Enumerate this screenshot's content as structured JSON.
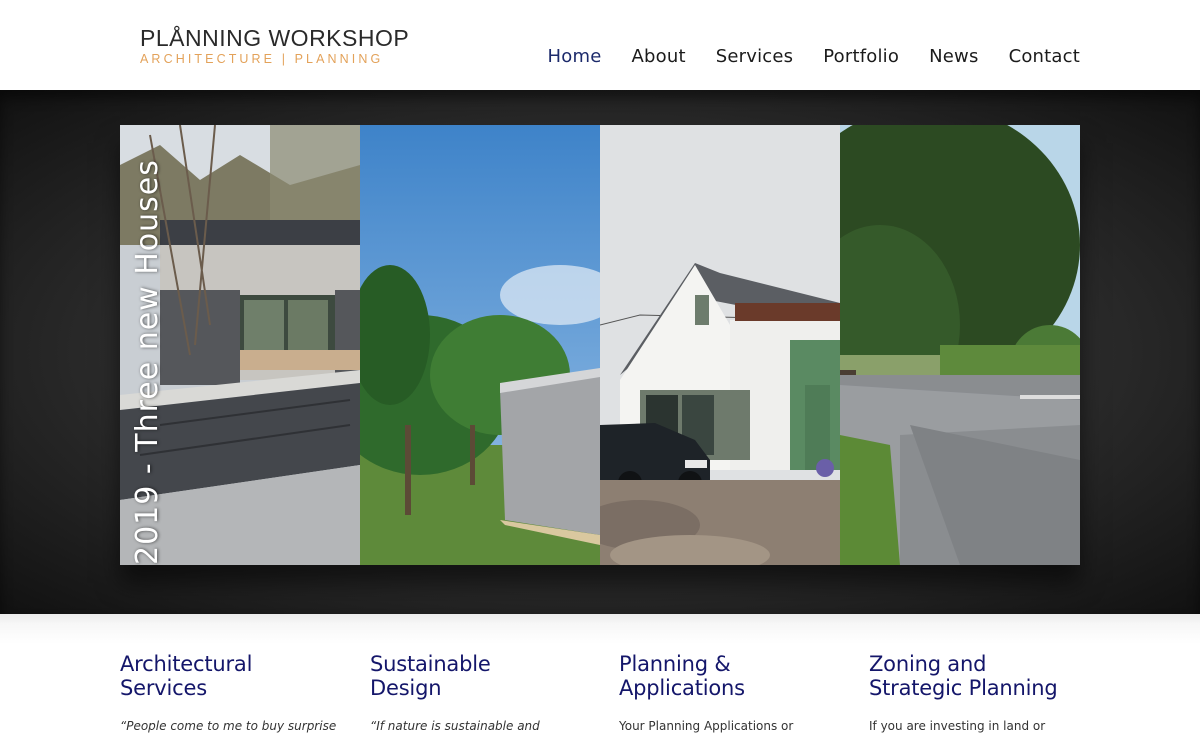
{
  "logo": {
    "main": "PLÅNNING WORKSHOP",
    "sub": "ARCHITECTURE | PLANNING"
  },
  "nav": {
    "items": [
      "Home",
      "About",
      "Services",
      "Portfolio",
      "News",
      "Contact"
    ],
    "active": "Home"
  },
  "hero": {
    "caption": "2019 - Three new Houses"
  },
  "services": [
    {
      "title_line1": "Architectural",
      "title_line2": "Services",
      "text": "“People come to me to buy surprise"
    },
    {
      "title_line1": "Sustainable",
      "title_line2": "Design",
      "text": "“If nature is sustainable and"
    },
    {
      "title_line1": "Planning &",
      "title_line2": "Applications",
      "text": "Your Planning Applications or"
    },
    {
      "title_line1": "Zoning and",
      "title_line2": "Strategic Planning",
      "text": "If you are investing in land or"
    }
  ],
  "colors": {
    "accent": "#14166a",
    "logo_sub": "#e3a25a",
    "nav_active": "#1c2a6b"
  }
}
